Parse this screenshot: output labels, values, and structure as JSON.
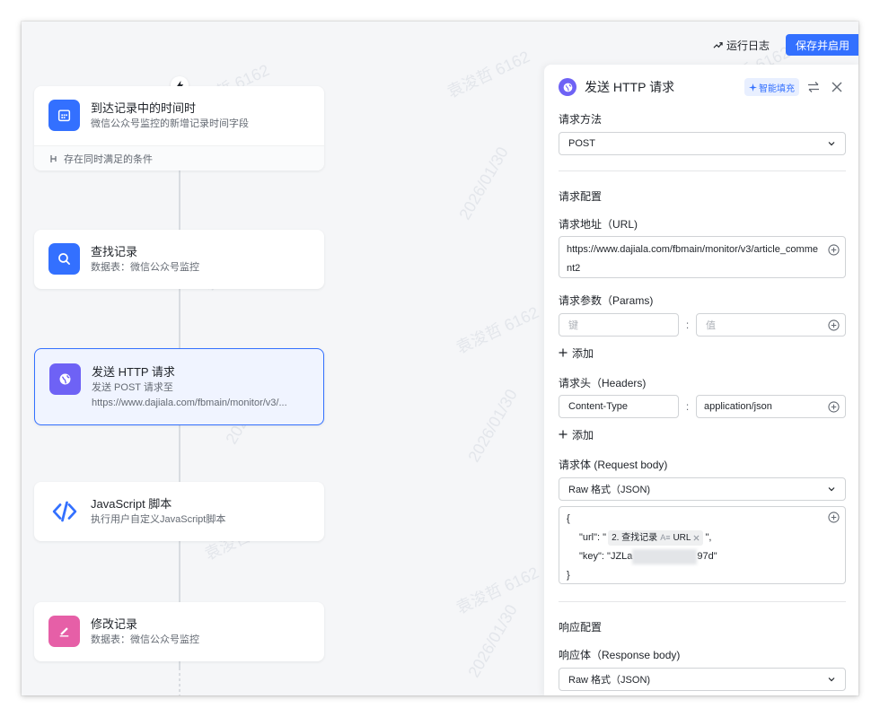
{
  "toolbar": {
    "log_label": "运行日志",
    "save_label": "保存并启用"
  },
  "flow": {
    "nodes": [
      {
        "title": "到达记录中的时间时",
        "subtitle": "微信公众号监控的新增记录时间字段",
        "footer": "存在同时满足的条件",
        "icon": "calendar-icon",
        "color": "#3370ff"
      },
      {
        "title": "查找记录",
        "subtitle": "数据表：微信公众号监控",
        "icon": "search-icon",
        "color": "#3370ff"
      },
      {
        "title": "发送 HTTP 请求",
        "subtitle": "发送 POST 请求至",
        "subtitle2": "https://www.dajiala.com/fbmain/monitor/v3/...",
        "icon": "globe-icon",
        "color": "#6e62f5"
      },
      {
        "title": "JavaScript 脚本",
        "subtitle": "执行用户自定义JavaScript脚本",
        "icon": "code-icon",
        "color": "#3370ff"
      },
      {
        "title": "修改记录",
        "subtitle": "数据表：微信公众号监控",
        "icon": "edit-icon",
        "color": "#e65fa7"
      }
    ]
  },
  "panel": {
    "title": "发送 HTTP 请求",
    "ai_fill": "智能填充",
    "method_label": "请求方法",
    "method_value": "POST",
    "config_heading": "请求配置",
    "url_label": "请求地址（URL)",
    "url_value": "https://www.dajiala.com/fbmain/monitor/v3/article_comment2",
    "params_label": "请求参数（Params)",
    "params_key_placeholder": "键",
    "params_value_placeholder": "值",
    "add_label": "添加",
    "headers_label": "请求头（Headers)",
    "header_key": "Content-Type",
    "header_value": "application/json",
    "body_label": "请求体 (Request body)",
    "body_format": "Raw 格式（JSON)",
    "body_json": {
      "open": "{",
      "url_prefix": "\"url\": \"",
      "ref_step": "2. 查找记录",
      "ref_field": "URL",
      "url_suffix": "\",",
      "key_prefix": "\"key\": \"JZLa",
      "key_suffix": "97d\"",
      "close": "}"
    },
    "response_heading": "响应配置",
    "response_label": "响应体（Response body)",
    "response_format": "Raw 格式（JSON)"
  },
  "watermark": {
    "text_a": "袁浚哲 6162",
    "text_b": "2026/01/30"
  }
}
